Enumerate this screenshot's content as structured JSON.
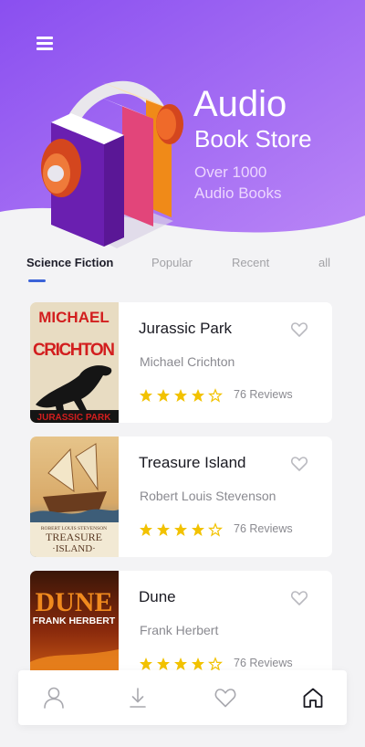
{
  "header": {
    "title": "Audio",
    "subtitle": "Book Store",
    "count_line1": "Over 1000",
    "count_line2": "Audio Books",
    "gradient_start": "#8a55f2",
    "gradient_end": "#b07bf5",
    "menu_icon": "menu-icon"
  },
  "tabs": [
    {
      "label": "Science Fiction",
      "active": true
    },
    {
      "label": "Popular",
      "active": false
    },
    {
      "label": "Recent",
      "active": false
    },
    {
      "label": "all",
      "active": false
    }
  ],
  "books": [
    {
      "title": "Jurassic Park",
      "author": "Michael Crichton",
      "rating": 4,
      "max_rating": 5,
      "reviews": "76 Reviews",
      "cover_text_top": "MICHAEL",
      "cover_text_mid": "CRICHTON",
      "cover_text_bottom": "JURASSIC PARK"
    },
    {
      "title": "Treasure Island",
      "author": "Robert Louis Stevenson",
      "rating": 4,
      "max_rating": 5,
      "reviews": "76 Reviews",
      "cover_text_top": "ROBERT LOUIS STEVENSON",
      "cover_text_mid": "TREASURE",
      "cover_text_bottom": "·ISLAND·"
    },
    {
      "title": "Dune",
      "author": "Frank Herbert",
      "rating": 4,
      "max_rating": 5,
      "reviews": "76 Reviews",
      "cover_text_top": "DUNE",
      "cover_text_mid": "FRANK HERBERT",
      "cover_text_bottom": ""
    }
  ],
  "bottom_nav": [
    {
      "icon": "user-icon",
      "active": false
    },
    {
      "icon": "download-icon",
      "active": false
    },
    {
      "icon": "heart-icon",
      "active": false
    },
    {
      "icon": "home-icon",
      "active": true
    }
  ],
  "colors": {
    "accent": "#3b63d8",
    "star": "#f2c200",
    "background": "#f3f3f5"
  }
}
